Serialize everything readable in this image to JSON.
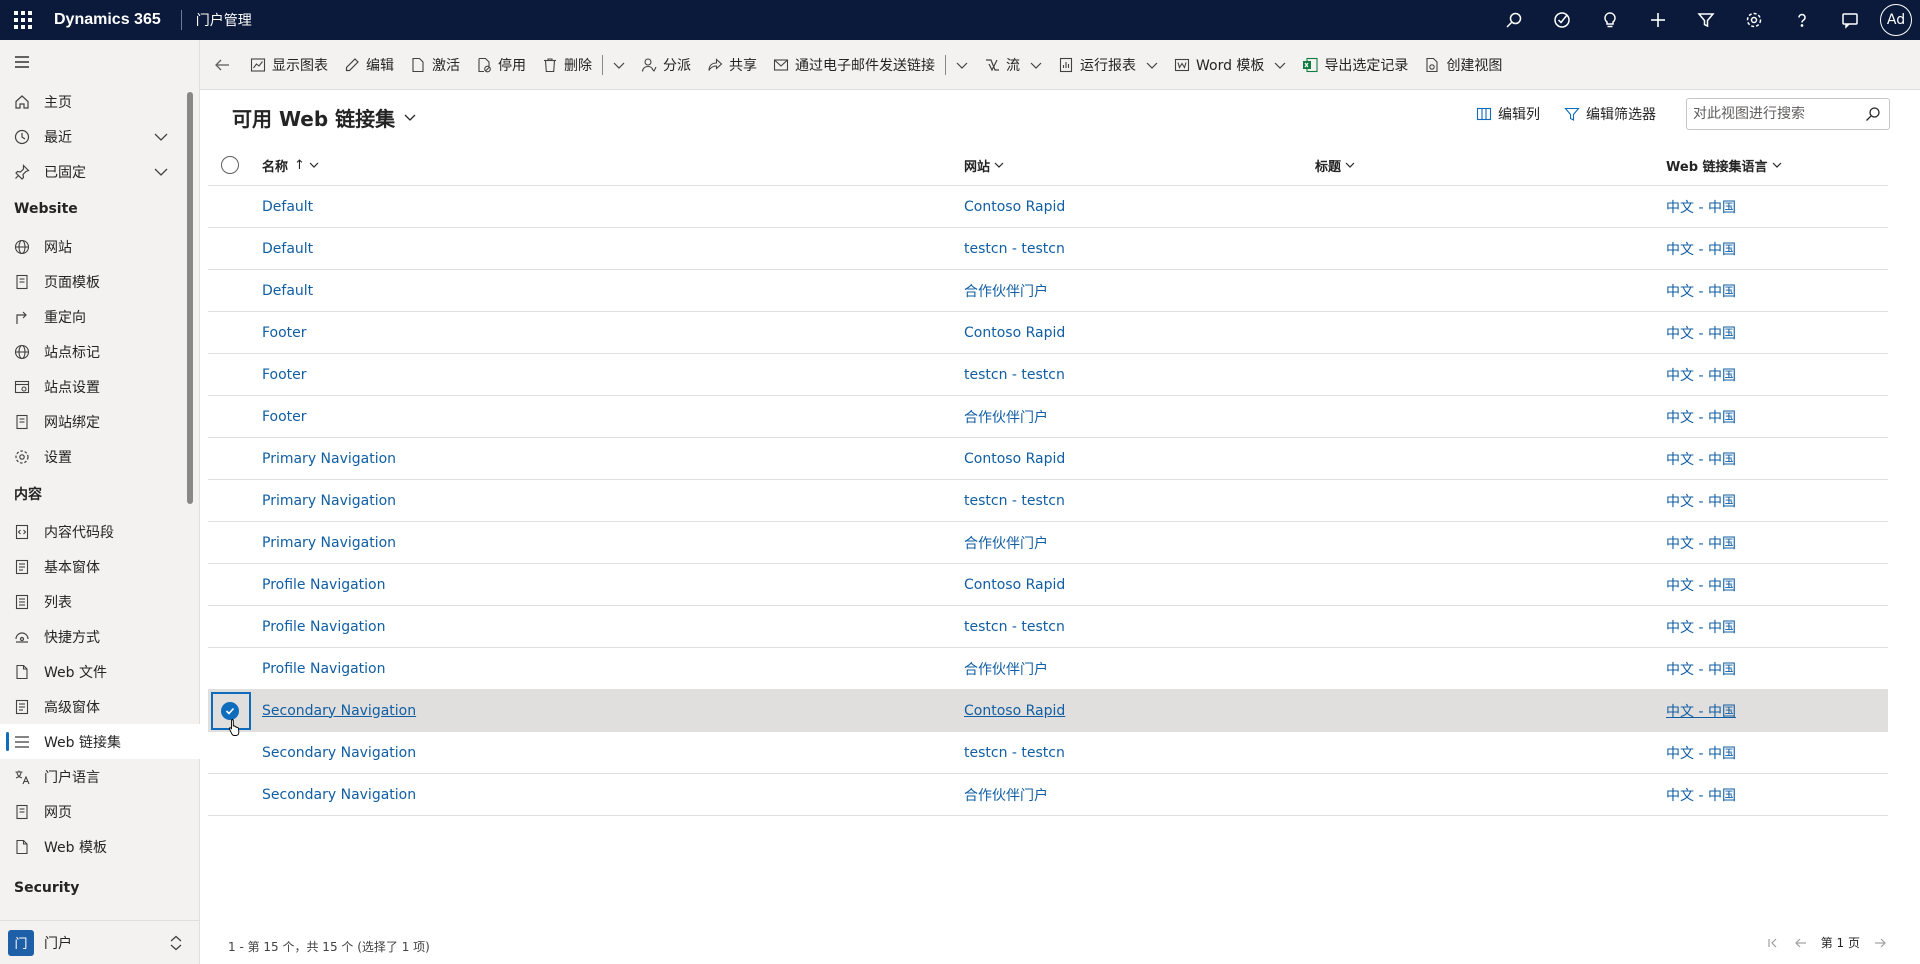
{
  "topbar": {
    "app_name": "Dynamics 365",
    "area_name": "门户管理",
    "avatar_initials": "Ad",
    "icons": [
      "search-icon",
      "task-icon",
      "lightbulb-icon",
      "plus-icon",
      "filter-icon",
      "gear-icon",
      "help-icon",
      "chat-icon"
    ]
  },
  "nav": {
    "items_top": [
      {
        "label": "主页",
        "icon": "home-icon"
      },
      {
        "label": "最近",
        "icon": "clock-icon"
      },
      {
        "label": "已固定",
        "icon": "pin-icon"
      }
    ],
    "group_website": "Website",
    "items_website": [
      {
        "label": "网站",
        "icon": "globe-icon"
      },
      {
        "label": "页面模板",
        "icon": "page-icon"
      },
      {
        "label": "重定向",
        "icon": "redirect-icon"
      },
      {
        "label": "站点标记",
        "icon": "globe-icon"
      },
      {
        "label": "站点设置",
        "icon": "settings-page-icon"
      },
      {
        "label": "网站绑定",
        "icon": "page-icon"
      },
      {
        "label": "设置",
        "icon": "gear-icon"
      }
    ],
    "group_content": "内容",
    "items_content": [
      {
        "label": "内容代码段",
        "icon": "code-icon"
      },
      {
        "label": "基本窗体",
        "icon": "form-icon"
      },
      {
        "label": "列表",
        "icon": "list-icon"
      },
      {
        "label": "快捷方式",
        "icon": "shortcut-icon"
      },
      {
        "label": "Web 文件",
        "icon": "file-icon"
      },
      {
        "label": "高级窗体",
        "icon": "form-icon"
      },
      {
        "label": "Web 链接集",
        "icon": "lines-icon"
      },
      {
        "label": "门户语言",
        "icon": "language-icon"
      },
      {
        "label": "网页",
        "icon": "page-icon"
      },
      {
        "label": "Web 模板",
        "icon": "file-icon"
      }
    ],
    "group_security": "Security",
    "area_badge": "门",
    "area_label": "门户"
  },
  "commands": {
    "show_chart": "显示图表",
    "edit": "编辑",
    "activate": "激活",
    "deactivate": "停用",
    "delete": "删除",
    "assign": "分派",
    "share": "共享",
    "email_link": "通过电子邮件发送链接",
    "flow": "流",
    "run_report": "运行报表",
    "word_template": "Word 模板",
    "export_selected": "导出选定记录",
    "create_view": "创建视图"
  },
  "view": {
    "title": "可用 Web 链接集",
    "edit_columns": "编辑列",
    "edit_filters": "编辑筛选器",
    "search_placeholder": "对此视图进行搜索"
  },
  "grid": {
    "columns": [
      "名称",
      "网站",
      "标题",
      "Web 链接集语言"
    ],
    "sort_arrow": "↑",
    "rows": [
      {
        "name": "Default",
        "site": "Contoso Rapid",
        "title": "",
        "lang": "中文 - 中国",
        "selected": false
      },
      {
        "name": "Default",
        "site": "testcn - testcn",
        "title": "",
        "lang": "中文 - 中国",
        "selected": false
      },
      {
        "name": "Default",
        "site": "合作伙伴门户",
        "title": "",
        "lang": "中文 - 中国",
        "selected": false
      },
      {
        "name": "Footer",
        "site": "Contoso Rapid",
        "title": "",
        "lang": "中文 - 中国",
        "selected": false
      },
      {
        "name": "Footer",
        "site": "testcn - testcn",
        "title": "",
        "lang": "中文 - 中国",
        "selected": false
      },
      {
        "name": "Footer",
        "site": "合作伙伴门户",
        "title": "",
        "lang": "中文 - 中国",
        "selected": false
      },
      {
        "name": "Primary Navigation",
        "site": "Contoso Rapid",
        "title": "",
        "lang": "中文 - 中国",
        "selected": false
      },
      {
        "name": "Primary Navigation",
        "site": "testcn - testcn",
        "title": "",
        "lang": "中文 - 中国",
        "selected": false
      },
      {
        "name": "Primary Navigation",
        "site": "合作伙伴门户",
        "title": "",
        "lang": "中文 - 中国",
        "selected": false
      },
      {
        "name": "Profile Navigation",
        "site": "Contoso Rapid",
        "title": "",
        "lang": "中文 - 中国",
        "selected": false
      },
      {
        "name": "Profile Navigation",
        "site": "testcn - testcn",
        "title": "",
        "lang": "中文 - 中国",
        "selected": false
      },
      {
        "name": "Profile Navigation",
        "site": "合作伙伴门户",
        "title": "",
        "lang": "中文 - 中国",
        "selected": false
      },
      {
        "name": "Secondary Navigation",
        "site": "Contoso Rapid",
        "title": "",
        "lang": "中文 - 中国",
        "selected": true
      },
      {
        "name": "Secondary Navigation",
        "site": "testcn - testcn",
        "title": "",
        "lang": "中文 - 中国",
        "selected": false
      },
      {
        "name": "Secondary Navigation",
        "site": "合作伙伴门户",
        "title": "",
        "lang": "中文 - 中国",
        "selected": false
      }
    ]
  },
  "footer": {
    "status": "1 - 第 15 个，共 15 个 (选择了 1 项)",
    "page_label": "第 1 页"
  },
  "colors": {
    "topbar": "#0b1a3a",
    "link": "#115ea3",
    "accent": "#0f6cbd",
    "selected_row": "#e1dfdd"
  }
}
